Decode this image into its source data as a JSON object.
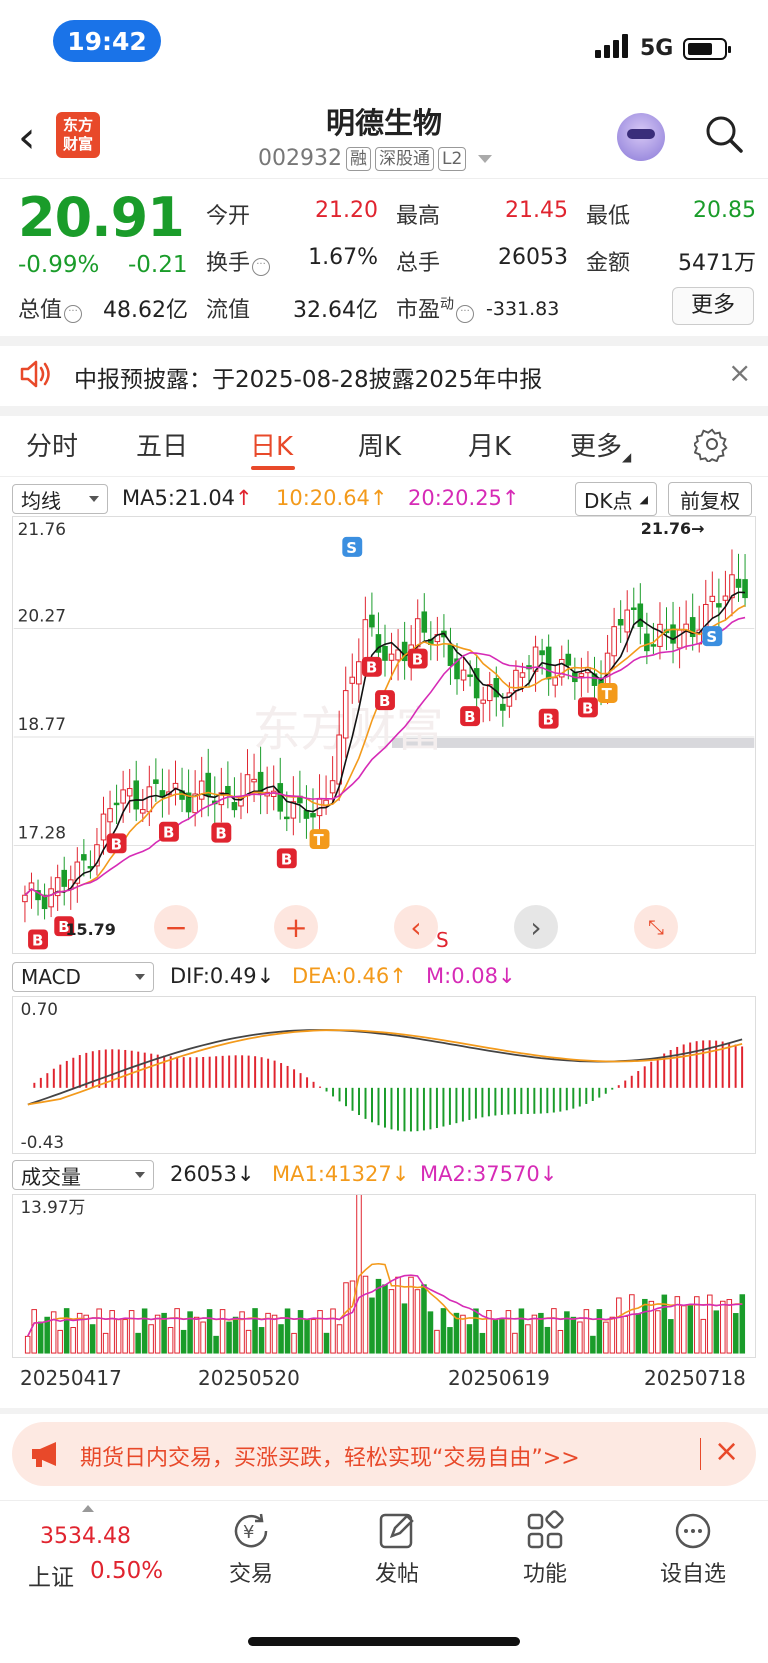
{
  "status_bar": {
    "time": "19:42",
    "network": "5G"
  },
  "header": {
    "title": "明德生物",
    "code": "002932",
    "tags": [
      "融",
      "深股通",
      "L2"
    ],
    "logo_text": "东方财富"
  },
  "quote": {
    "price": "20.91",
    "change_pct": "-0.99%",
    "change": "-0.21",
    "open_label": "今开",
    "open": "21.20",
    "high_label": "最高",
    "high": "21.45",
    "low_label": "最低",
    "low": "20.85",
    "turnover_label": "换手",
    "turnover": "1.67%",
    "volume_label": "总手",
    "volume": "26053",
    "amount_label": "金额",
    "amount": "5471万",
    "mktcap_label": "总值",
    "mktcap": "48.62亿",
    "float_label": "流值",
    "float_cap": "32.64亿",
    "pe_label": "市盈",
    "pe_sup": "动",
    "pe": "-331.83",
    "more_label": "更多"
  },
  "notice": {
    "text": "中报预披露：于2025-08-28披露2025年中报"
  },
  "tabs": [
    "分时",
    "五日",
    "日K",
    "周K",
    "月K",
    "更多"
  ],
  "active_tab": "日K",
  "kline": {
    "indicator": "均线",
    "ma5": "MA5:21.04",
    "ma10": "10:20.64",
    "ma20": "20:20.25",
    "dk_label": "DK点",
    "adjust_label": "前复权",
    "y_ticks": [
      "21.76",
      "20.27",
      "18.77",
      "17.28",
      "15.79"
    ],
    "high_marker": "21.76→",
    "low_marker": "15.79",
    "s_label": "S"
  },
  "macd": {
    "indicator": "MACD",
    "dif": "DIF:0.49",
    "dea": "DEA:0.46",
    "m": "M:0.08",
    "y_ticks": [
      "0.70",
      "-0.43"
    ]
  },
  "volume": {
    "indicator": "成交量",
    "value": "26053",
    "ma1": "MA1:41327",
    "ma2": "MA2:37570",
    "y_top": "13.97万",
    "dates": [
      "20250417",
      "20250520",
      "20250619",
      "20250718"
    ]
  },
  "ad": {
    "text": "期货日内交易，买涨买跌，轻松实现“交易自由”>>"
  },
  "bottom": {
    "index_value": "3534.48",
    "index_name": "上证",
    "index_pct": "0.50%",
    "items": [
      "交易",
      "发帖",
      "功能",
      "设自选"
    ]
  },
  "colors": {
    "up": "#e0242f",
    "down": "#1a9c2a",
    "ma10": "#f39a1b",
    "ma20": "#d62bb6",
    "accent": "#e8492a"
  }
}
